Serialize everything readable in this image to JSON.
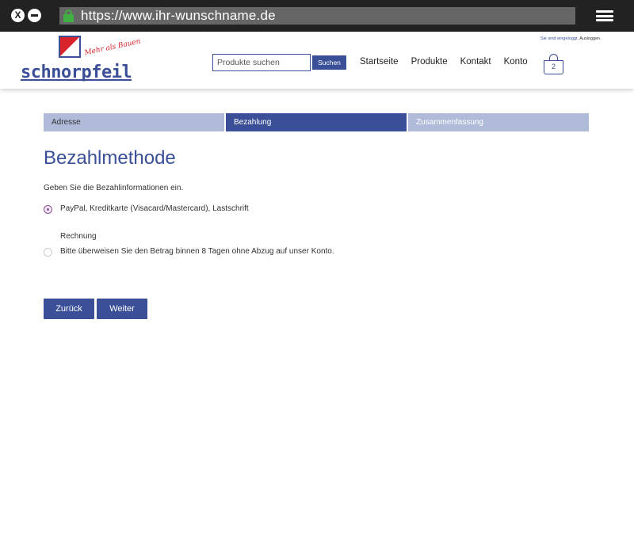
{
  "browser": {
    "url": "https://www.ihr-wunschname.de",
    "close_glyph": "X"
  },
  "header": {
    "logo_word": "schnorpfeil",
    "logo_tagline": "Mehr als Bauen",
    "login_status_highlight": "Sie sind eingeloggt.",
    "login_status_logout": "Ausloggen.",
    "search_placeholder": "Produkte suchen",
    "search_button": "Suchen",
    "nav": [
      "Startseite",
      "Produkte",
      "Kontakt",
      "Konto"
    ],
    "cart_count": "2"
  },
  "steps": [
    {
      "label": "Adresse",
      "state": "done"
    },
    {
      "label": "Bezahlung",
      "state": "active"
    },
    {
      "label": "Zusammenfassung",
      "state": "upcoming"
    }
  ],
  "main": {
    "title": "Bezahlmethode",
    "intro": "Geben Sie die Bezahlinformationen ein.",
    "options": [
      {
        "label": "PayPal, Kreditkarte (Visacard/Mastercard), Lastschrift",
        "checked": true
      },
      {
        "title": "Rechnung",
        "label": "Bitte überweisen Sie den Betrag binnen 8 Tagen ohne Abzug auf unser Konto.",
        "checked": false
      }
    ],
    "back_button": "Zurück",
    "next_button": "Weiter"
  },
  "colors": {
    "brand_blue": "#3a4f97",
    "step_inactive": "#afbbd9",
    "logo_red": "#d8232a",
    "radio_accent": "#8e4f98"
  }
}
